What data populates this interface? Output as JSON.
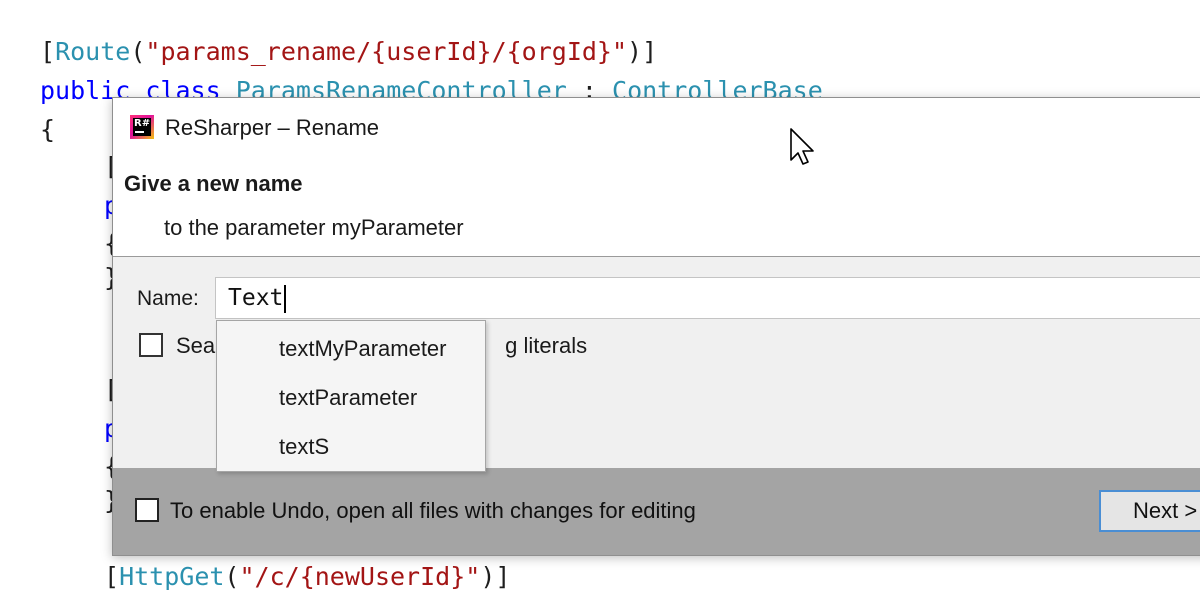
{
  "editor": {
    "line1": {
      "open": "[",
      "attr": "Route",
      "paren_open": "(",
      "string": "\"params_rename/{userId}/{orgId}\"",
      "close": ")]"
    },
    "line2": {
      "kw1": "public",
      "kw2": "class",
      "class_name": "ParamsRenameController",
      "colon": ":",
      "base": "ControllerBase"
    },
    "line3": {
      "brace": "{"
    },
    "partials": [
      "[",
      "p",
      "{",
      "}",
      "[",
      "p",
      "{",
      "}"
    ],
    "last_line": {
      "open": "[",
      "attr": "HttpGet",
      "paren_open": "(",
      "string": "\"/c/{newUserId}\"",
      "close": ")]"
    }
  },
  "dialog": {
    "title": "ReSharper – Rename",
    "logo_text": "R#",
    "heading": "Give a new name",
    "subheading": "to the parameter myParameter",
    "name_label": "Name:",
    "name_value": "Text",
    "search_label_start": "Sea",
    "search_label_end": "g literals",
    "undo_label": "To enable Undo, open all files with changes for editing",
    "next_label": "Next >"
  },
  "autocomplete": {
    "items": [
      "textMyParameter",
      "textParameter",
      "textS"
    ]
  },
  "colors": {
    "keyword": "#0000ff",
    "type": "#2b91af",
    "string": "#a31515",
    "footer": "#a4a4a4",
    "button_border": "#4a8ed4"
  },
  "icons": {
    "logo": "resharper-logo-icon",
    "pointer": "mouse-pointer-icon"
  }
}
